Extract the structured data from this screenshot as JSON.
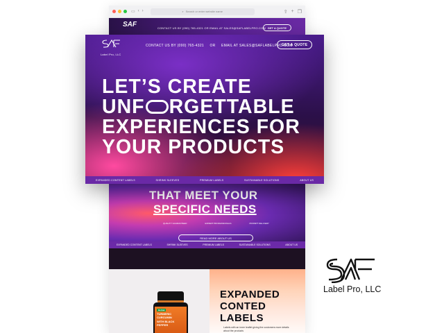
{
  "browser": {
    "url_placeholder": "Search or enter website name",
    "header": {
      "contact": "CONTACT US BY (090) 765-4321     OR     EMAIL AT SALES@SAFLABELPRO.COM",
      "quote": "GET A QUOTE"
    },
    "hero": {
      "line1": "THAT MEET YOUR",
      "line2": "SPECIFIC NEEDS",
      "features": [
        "QUALITY GUARANTEED",
        "EXPERT PROFESSIONALS",
        "PROMPT DELIVERY"
      ],
      "learn_more": "READ MORE ABOUT US"
    },
    "nav": [
      "EXPANDED CONTENT LABELS",
      "SHRINK SLEEVES",
      "PREMIUM LABELS",
      "SUSTAINABLE SOLUTIONS",
      "ABOUT US"
    ],
    "product": {
      "label_brand": "Herbal",
      "label_name": "TURMERIC CURCUMIN",
      "label_tag": "WITH BLACK PEPPER"
    },
    "expanded": {
      "title_lines": [
        "EXPANDED",
        "CONTED",
        "LABELS"
      ],
      "bullet": "Labels with an inner leaflet giving the customers more details about the products"
    }
  },
  "card": {
    "logo_small": "Label Pro, LLC",
    "contact_phone": "CONTACT US BY (090) 765-4321",
    "contact_or": "OR",
    "contact_email": "EMAIL AT SALES@SAFLABELPRO.COM",
    "quote": "GET A QUOTE",
    "title": {
      "row1": "LET’S CREATE",
      "row2_a": "UNF",
      "row2_b": "RGETTABLE",
      "row3": "EXPERIENCES FOR",
      "row4": "YOUR PRODUCTS"
    },
    "nav": [
      "EXPANDED CONTENT LABELS",
      "SHRINK SLEEVES",
      "PREMIUM LABELS",
      "SUSTAINABLE SOLUTIONS",
      "ABOUT US"
    ]
  },
  "brand": {
    "name": "Label Pro, LLC"
  },
  "colors": {
    "purple_nav": "#6a29a6",
    "dark_bg": "#2b1048",
    "accent_red": "#ff3f3a",
    "accent_pink": "#ff4aa0"
  }
}
